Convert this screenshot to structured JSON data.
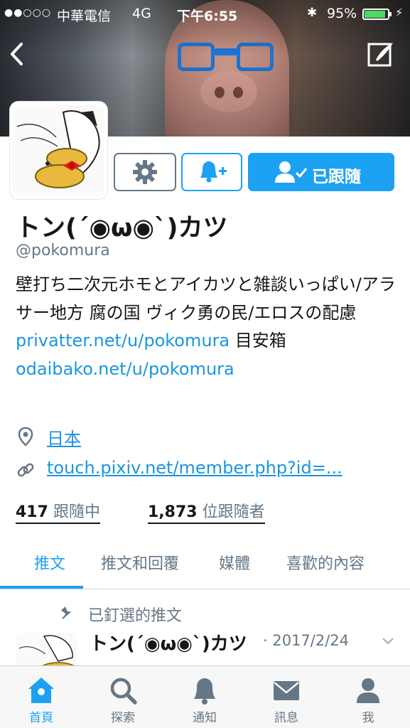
{
  "status_bar": {
    "signal": "●●○○○",
    "carrier": "中華電信",
    "network": "4G",
    "time": "下午6:55",
    "battery_percent": "95%",
    "battery_level": 0.95,
    "icons": [
      "bluetooth-icon",
      "battery-icon",
      "charging-icon"
    ]
  },
  "header": {
    "back_icon": "back-chevron-icon",
    "compose_icon": "compose-icon"
  },
  "actions": {
    "settings_icon": "gear-icon",
    "notify_icon": "bell-plus-icon",
    "follow_icon": "person-check-icon",
    "follow_label": "已跟隨"
  },
  "profile": {
    "name": "トン(´◉ω◉`)カツ",
    "handle": "@pokomura",
    "bio_text_1": "壁打ち二次元ホモとアイカツと雑談いっぱい/アラサー地方 腐の国 ヴィク勇の民/エロスの配慮",
    "bio_link_1": "privatter.net/u/pokomura",
    "bio_text_2": " 目安箱",
    "bio_link_2": "odaibako.net/u/pokomura",
    "location": "日本",
    "url": "touch.pixiv.net/member.php?id=...",
    "following_count": "417",
    "following_label": "跟隨中",
    "followers_count": "1,873",
    "followers_label": "位跟隨者"
  },
  "tabs": [
    {
      "label": "推文",
      "active": true
    },
    {
      "label": "推文和回覆",
      "active": false
    },
    {
      "label": "媒體",
      "active": false
    },
    {
      "label": "喜歡的內容",
      "active": false
    }
  ],
  "pinned_tweet": {
    "pinned_label": "已釘選的推文",
    "author": "トン(´◉ω◉`)カツ",
    "date": "· 2017/2/24"
  },
  "tab_bar": [
    {
      "label": "首頁",
      "icon": "home-icon",
      "active": true
    },
    {
      "label": "探索",
      "icon": "search-icon",
      "active": false
    },
    {
      "label": "通知",
      "icon": "bell-icon",
      "active": false
    },
    {
      "label": "訊息",
      "icon": "mail-icon",
      "active": false
    },
    {
      "label": "我",
      "icon": "person-icon",
      "active": false
    }
  ],
  "colors": {
    "accent": "#1da1f2",
    "link": "#1b95e0",
    "secondary_text": "#657786",
    "battery_fill": "#4cd964"
  }
}
